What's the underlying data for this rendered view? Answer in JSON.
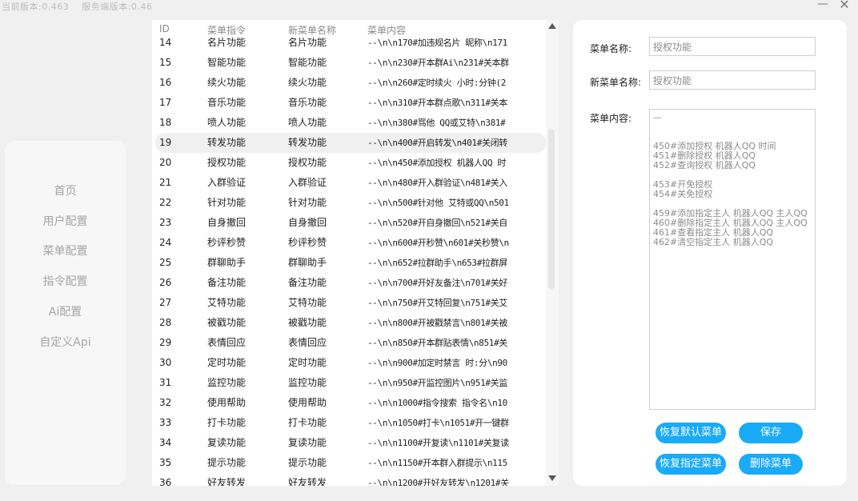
{
  "header": {
    "client_version_label": "当前版本:0.463",
    "server_version_label": "服务端版本:0.46",
    "minimize_glyph": "—",
    "close_glyph": "✕"
  },
  "sidebar": {
    "items": [
      {
        "label": "首页"
      },
      {
        "label": "用户配置"
      },
      {
        "label": "菜单配置"
      },
      {
        "label": "指令配置"
      },
      {
        "label": "Ai配置"
      },
      {
        "label": "自定义Api"
      }
    ]
  },
  "menu_list": {
    "headers": {
      "id": "ID",
      "command": "菜单指令",
      "new_name": "新菜单名称",
      "content": "菜单内容"
    },
    "selected_id": "19",
    "rows": [
      {
        "id": "14",
        "command": "名片功能",
        "new_name": "名片功能",
        "content": "--\\n\\n170#加违规名片  昵称\\n171"
      },
      {
        "id": "15",
        "command": "智能功能",
        "new_name": "智能功能",
        "content": "--\\n\\n230#开本群Ai\\n231#关本群"
      },
      {
        "id": "16",
        "command": "续火功能",
        "new_name": "续火功能",
        "content": "--\\n\\n260#定时续火 小时:分钟(2"
      },
      {
        "id": "17",
        "command": "音乐功能",
        "new_name": "音乐功能",
        "content": "--\\n\\n310#开本群点歌\\n311#关本"
      },
      {
        "id": "18",
        "command": "喷人功能",
        "new_name": "喷人功能",
        "content": "--\\n\\n380#骂他 QQ或艾特\\n381#"
      },
      {
        "id": "19",
        "command": "转发功能",
        "new_name": "转发功能",
        "content": "--\\n\\n400#开启转发\\n401#关闭转"
      },
      {
        "id": "20",
        "command": "授权功能",
        "new_name": "授权功能",
        "content": "--\\n\\n450#添加授权  机器人QQ 时"
      },
      {
        "id": "21",
        "command": "入群验证",
        "new_name": "入群验证",
        "content": "--\\n\\n480#开入群验证\\n481#关入"
      },
      {
        "id": "22",
        "command": "针对功能",
        "new_name": "针对功能",
        "content": "--\\n\\n500#针对他  艾特或QQ\\n501"
      },
      {
        "id": "23",
        "command": "自身撤回",
        "new_name": "自身撤回",
        "content": "--\\n\\n520#开自身撤回\\n521#关自"
      },
      {
        "id": "24",
        "command": "秒评秒赞",
        "new_name": "秒评秒赞",
        "content": "--\\n\\n600#开秒赞\\n601#关秒赞\\n"
      },
      {
        "id": "25",
        "command": "群聊助手",
        "new_name": "群聊助手",
        "content": "--\\n\\n652#拉群助手\\n653#拉群屏"
      },
      {
        "id": "26",
        "command": "备注功能",
        "new_name": "备注功能",
        "content": "--\\n\\n700#开好友备注\\n701#关好"
      },
      {
        "id": "27",
        "command": "艾特功能",
        "new_name": "艾特功能",
        "content": "--\\n\\n750#开艾特回复\\n751#关艾"
      },
      {
        "id": "28",
        "command": "被戳功能",
        "new_name": "被戳功能",
        "content": "--\\n\\n800#开被戳禁言\\n801#关被"
      },
      {
        "id": "29",
        "command": "表情回应",
        "new_name": "表情回应",
        "content": "--\\n\\n850#开本群贴表情\\n851#关"
      },
      {
        "id": "30",
        "command": "定时功能",
        "new_name": "定时功能",
        "content": "--\\n\\n900#加定时禁言  时:分\\n90"
      },
      {
        "id": "31",
        "command": "监控功能",
        "new_name": "监控功能",
        "content": "--\\n\\n950#开监控图片\\n951#关监"
      },
      {
        "id": "32",
        "command": "使用帮助",
        "new_name": "使用帮助",
        "content": "--\\n\\n1000#指令搜索  指令名\\n10"
      },
      {
        "id": "33",
        "command": "打卡功能",
        "new_name": "打卡功能",
        "content": "--\\n\\n1050#打卡\\n1051#开一键群"
      },
      {
        "id": "34",
        "command": "复读功能",
        "new_name": "复读功能",
        "content": "--\\n\\n1100#开复读\\n1101#关复读"
      },
      {
        "id": "35",
        "command": "提示功能",
        "new_name": "提示功能",
        "content": "--\\n\\n1150#开本群入群提示\\n115"
      },
      {
        "id": "36",
        "command": "好友转发",
        "new_name": "好友转发",
        "content": "--\\n\\n1200#开好友转发\\n1201#关"
      }
    ]
  },
  "detail": {
    "menu_name_label": "菜单名称:",
    "menu_name_value": "授权功能",
    "new_menu_name_label": "新菜单名称:",
    "new_menu_name_value": "授权功能",
    "menu_content_label": "菜单内容:",
    "menu_content_value": "—\n\n\n450#添加授权 机器人QQ 时间\n451#删除授权 机器人QQ\n452#查询授权 机器人QQ\n\n453#开免授权\n454#关免授权\n\n459#添加指定主人 机器人QQ 主人QQ\n460#删除指定主人 机器人QQ 主人QQ\n461#查看指定主人 机器人QQ\n462#清空指定主人 机器人QQ",
    "buttons": {
      "restore_default": "恢复默认菜单",
      "save": "保存",
      "restore_specified": "恢复指定菜单",
      "delete": "删除菜单"
    }
  },
  "colors": {
    "accent_button": "#19aaf8",
    "selected_row": "#f0f0f0",
    "nav_text": "#a5a5a5"
  }
}
